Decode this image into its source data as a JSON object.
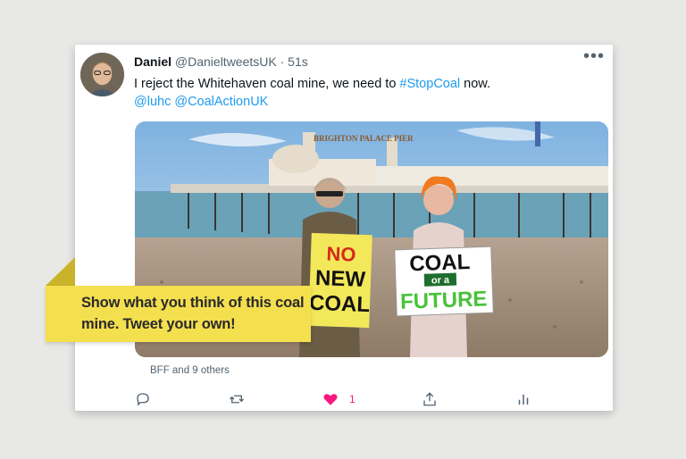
{
  "tweet": {
    "display_name": "Daniel",
    "handle": "@DanieltweetsUK",
    "separator": "·",
    "time": "51s",
    "text_plain": "I reject the Whitehaven coal mine, we need to ",
    "hashtag": "#StopCoal",
    "text_after": " now.",
    "mentions": "@luhc @CoalActionUK"
  },
  "image": {
    "pier_sign": "BRIGHTON PALACE PIER",
    "sign1_lines": [
      "NO",
      "NEW",
      "COAL"
    ],
    "sign2_lines": [
      "COAL",
      "or a",
      "FUTURE"
    ]
  },
  "engagement": {
    "liked_by": "BFF and 9 others",
    "like_count": "1"
  },
  "actions": {
    "icons": [
      "reply-icon",
      "retweet-icon",
      "heart-icon",
      "share-icon",
      "analytics-icon"
    ]
  },
  "callout": {
    "text": "Show what you think of this coal mine. Tweet your own!"
  },
  "colors": {
    "link": "#1d9bf0",
    "like": "#f91880",
    "callout": "#f4df4f"
  }
}
